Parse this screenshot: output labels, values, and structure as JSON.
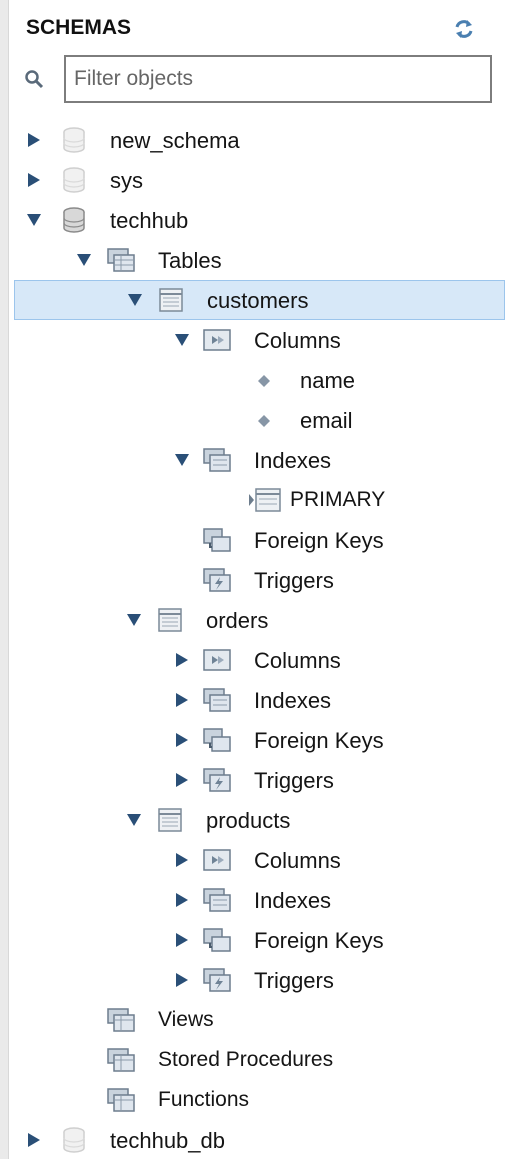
{
  "header": {
    "title": "SCHEMAS"
  },
  "search": {
    "placeholder": "Filter objects",
    "value": ""
  },
  "tree": {
    "nodes": [
      {
        "label": "new_schema"
      },
      {
        "label": "sys"
      },
      {
        "label": "techhub"
      },
      {
        "label": "Tables"
      },
      {
        "label": "customers"
      },
      {
        "label": "Columns"
      },
      {
        "label": "name"
      },
      {
        "label": "email"
      },
      {
        "label": "Indexes"
      },
      {
        "label": "PRIMARY"
      },
      {
        "label": "Foreign Keys"
      },
      {
        "label": "Triggers"
      },
      {
        "label": "orders"
      },
      {
        "label": "Columns"
      },
      {
        "label": "Indexes"
      },
      {
        "label": "Foreign Keys"
      },
      {
        "label": "Triggers"
      },
      {
        "label": "products"
      },
      {
        "label": "Columns"
      },
      {
        "label": "Indexes"
      },
      {
        "label": "Foreign Keys"
      },
      {
        "label": "Triggers"
      },
      {
        "label": "Views"
      },
      {
        "label": "Stored Procedures"
      },
      {
        "label": "Functions"
      },
      {
        "label": "techhub_db"
      }
    ]
  },
  "colors": {
    "selection_bg": "#d7e8f8",
    "selection_border": "#9cc5ec",
    "refresh_icon": "#4a7fb0"
  }
}
